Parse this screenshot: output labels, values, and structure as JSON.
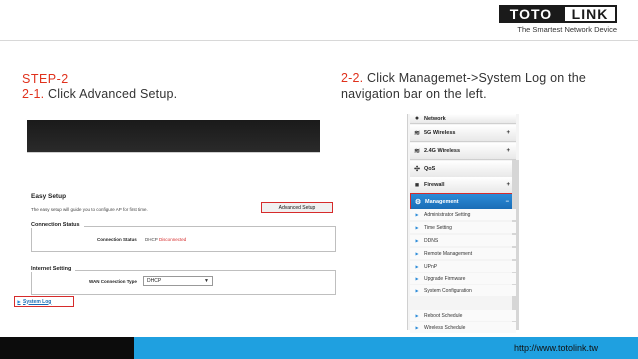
{
  "logo": {
    "part1": "TOTO",
    "part2": "LINK",
    "tagline": "The Smartest Network Device"
  },
  "step": {
    "title": "STEP-2",
    "line1_num": "2-1.",
    "line1_text": " Click Advanced Setup.",
    "line2_num": "2-2.",
    "line2_text": " Click Managemet->System Log on the",
    "line2_cont": "navigation bar on the left."
  },
  "easy_setup": {
    "title": "Easy Setup",
    "description": "The easy setup will guide you to configure AP for first time.",
    "advanced_button": "Advanced Setup",
    "connection_status": {
      "title": "Connection Status",
      "label": "Connection Status",
      "mode": "DHCP",
      "status": "Disconnected"
    },
    "internet_setting": {
      "title": "Internet Setting",
      "label": "WAN Connection Type",
      "selected": "DHCP"
    }
  },
  "nav": {
    "items": [
      {
        "label": "Network",
        "icon": "network-icon"
      },
      {
        "label": "5G Wireless",
        "icon": "wifi-icon"
      },
      {
        "label": "2.4G Wireless",
        "icon": "wifi-icon"
      },
      {
        "label": "QoS",
        "icon": "qos-icon"
      },
      {
        "label": "Firewall",
        "icon": "lock-icon"
      },
      {
        "label": "Management",
        "icon": "gear-icon"
      }
    ],
    "subitems": [
      "Administrator Setting",
      "Time Setting",
      "DDNS",
      "Remote Management",
      "UPnP",
      "Upgrade Firmware",
      "System Configuration",
      "System Log",
      "Reboot Schedule",
      "Wireless Schedule"
    ]
  },
  "footer": {
    "url": "http://www.totolink.tw"
  },
  "colors": {
    "accent_red": "#e0311c",
    "highlight_red": "#d62b2b",
    "nav_blue": "#1a6db6",
    "footer_blue": "#1fa0e0"
  }
}
